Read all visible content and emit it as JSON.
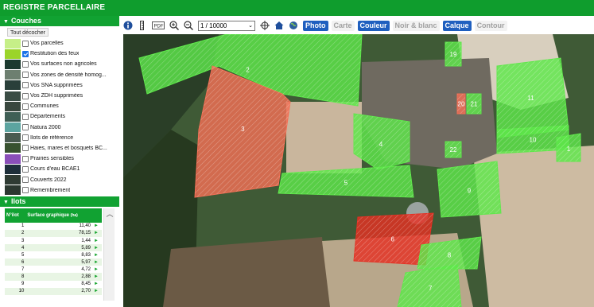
{
  "app": {
    "title": "REGISTRE PARCELLAIRE"
  },
  "layers_panel": {
    "title": "Couches",
    "toggle_all": "Tout décocher",
    "items": [
      {
        "label": "Vos parcelles",
        "checked": false,
        "swatch": "#c6ef88"
      },
      {
        "label": "Restitution des feux",
        "checked": true,
        "swatch": "#9bd42a"
      },
      {
        "label": "Vos surfaces non agricoles",
        "checked": false,
        "swatch": "#1c3a2f"
      },
      {
        "label": "Vos zones de densité homog...",
        "checked": false,
        "swatch": "#6d7f70"
      },
      {
        "label": "Vos SNA supprimées",
        "checked": false,
        "swatch": "#2a3f3a"
      },
      {
        "label": "Vos ZDH supprimées",
        "checked": false,
        "swatch": "#3a4c44"
      },
      {
        "label": "Communes",
        "checked": false,
        "swatch": "#39473e"
      },
      {
        "label": "Départements",
        "checked": false,
        "swatch": "#3f5f55"
      },
      {
        "label": "Natura 2000",
        "checked": false,
        "swatch": "#5ca4a0"
      },
      {
        "label": "Ilots de référence",
        "checked": false,
        "swatch": "#4a5b50"
      },
      {
        "label": "Haies, mares et bosquets BC...",
        "checked": false,
        "swatch": "#38522f"
      },
      {
        "label": "Prairies sensibles",
        "checked": false,
        "swatch": "#8a4fb8"
      },
      {
        "label": "Cours d'eau BCAE1",
        "checked": false,
        "swatch": "#1e2f3a"
      },
      {
        "label": "Couverts 2022",
        "checked": false,
        "swatch": "#2f3b33"
      },
      {
        "label": "Remembrement",
        "checked": false,
        "swatch": "#2c3830"
      }
    ]
  },
  "ilots_panel": {
    "title": "Ilots",
    "col_num": "N°ilot",
    "col_surface": "Surface graphique",
    "col_unit": "(ha)",
    "rows": [
      {
        "num": "1",
        "surface": "11,40"
      },
      {
        "num": "2",
        "surface": "78,15"
      },
      {
        "num": "3",
        "surface": "1,44"
      },
      {
        "num": "4",
        "surface": "5,89"
      },
      {
        "num": "5",
        "surface": "8,83"
      },
      {
        "num": "6",
        "surface": "5,97"
      },
      {
        "num": "7",
        "surface": "4,72"
      },
      {
        "num": "8",
        "surface": "2,88"
      },
      {
        "num": "9",
        "surface": "8,45"
      },
      {
        "num": "10",
        "surface": "2,70"
      }
    ]
  },
  "toolbar": {
    "info_icon": "info-icon",
    "scale": "1 / 10000",
    "buttons": [
      {
        "label": "Photo",
        "active": true
      },
      {
        "label": "Carte",
        "active": false
      },
      {
        "label": "Couleur",
        "active": true
      },
      {
        "label": "Noir & blanc",
        "active": false
      },
      {
        "label": "Calque",
        "active": true
      },
      {
        "label": "Contour",
        "active": false
      }
    ]
  },
  "map": {
    "plots": [
      {
        "label": "1",
        "color": "#5ee84a"
      },
      {
        "label": "2",
        "color": "#5ee84a"
      },
      {
        "label": "3",
        "color": "#f36f55"
      },
      {
        "label": "4",
        "color": "#5ee84a"
      },
      {
        "label": "5",
        "color": "#5ee84a"
      },
      {
        "label": "6",
        "color": "#e52f22"
      },
      {
        "label": "7",
        "color": "#5ee84a"
      },
      {
        "label": "8",
        "color": "#5ee84a"
      },
      {
        "label": "9",
        "color": "#5ee84a"
      },
      {
        "label": "10",
        "color": "#5ee84a"
      },
      {
        "label": "11",
        "color": "#5ee84a"
      },
      {
        "label": "19",
        "color": "#5ee84a"
      },
      {
        "label": "20",
        "color": "#f36f55"
      },
      {
        "label": "21",
        "color": "#5ee84a"
      },
      {
        "label": "22",
        "color": "#5ee84a"
      }
    ]
  }
}
